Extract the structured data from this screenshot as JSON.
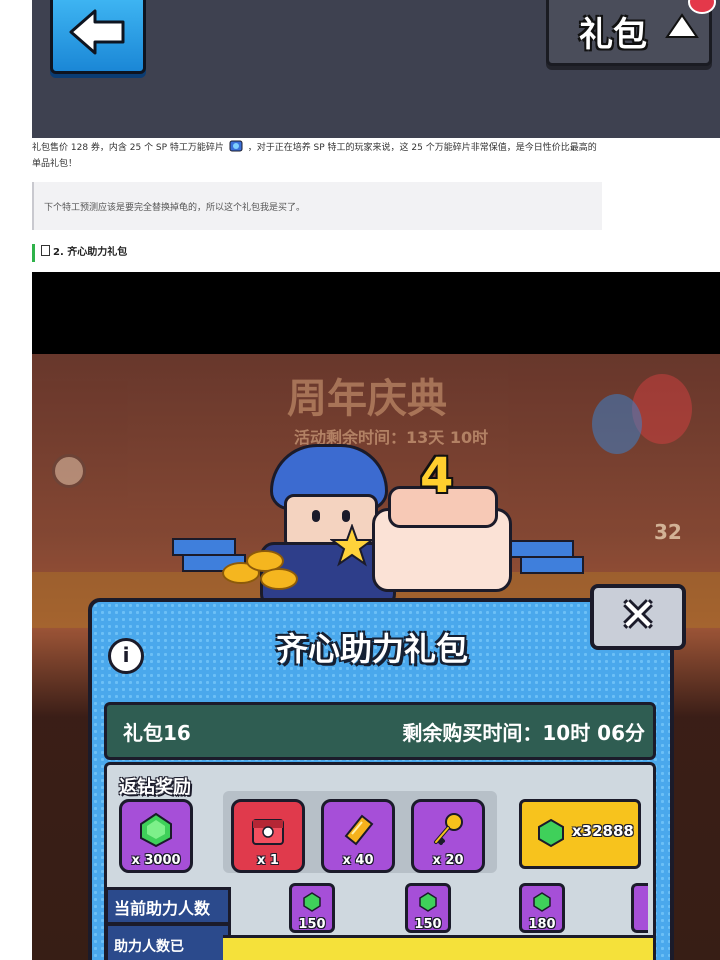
{
  "top_screenshot": {
    "pack_button_label": "礼包"
  },
  "article": {
    "paragraph_1_a": "礼包售价 128 券，内含 25 个 SP 特工万能碎片",
    "paragraph_1_b": "，对于正在培养 SP 特工的玩家来说，这 25 个万能碎片非常保值，是今日性价比最高的单品礼包！",
    "quote": "下个特工预测应该是要完全替换掉龟的，所以这个礼包我是买了。",
    "heading": "2. 齐心助力礼包"
  },
  "game_screenshot": {
    "background_title": "周年庆典",
    "background_subtitle": "活动剩余时间：13天 10时",
    "background_number": "32",
    "cake_number": "4",
    "dialog": {
      "title": "齐心助力礼包",
      "info_glyph": "i",
      "close_glyph": "✕",
      "pack_id": "礼包16",
      "remaining_time": "剩余购买时间：10时 06分",
      "reward_label": "返钻奖励",
      "rewards": [
        {
          "qty": "x 3000",
          "icon": "green-gem-icon",
          "color": "#a64fd8"
        },
        {
          "qty": "x 1",
          "icon": "red-chest-icon",
          "color": "#e03a4c"
        },
        {
          "qty": "x 40",
          "icon": "gold-ticket-icon",
          "color": "#a64fd8"
        },
        {
          "qty": "x 20",
          "icon": "gold-key-icon",
          "color": "#a64fd8"
        }
      ],
      "price": "x32888",
      "helpers_label": "当前助力人数",
      "helpers_label_2": "助力人数已",
      "milestones": [
        "150",
        "150",
        "180"
      ]
    }
  },
  "colors": {
    "heading_bar": "#2fb24a",
    "dialog_blue": "#4aa8ec",
    "buy_button": "#f7c31d"
  }
}
